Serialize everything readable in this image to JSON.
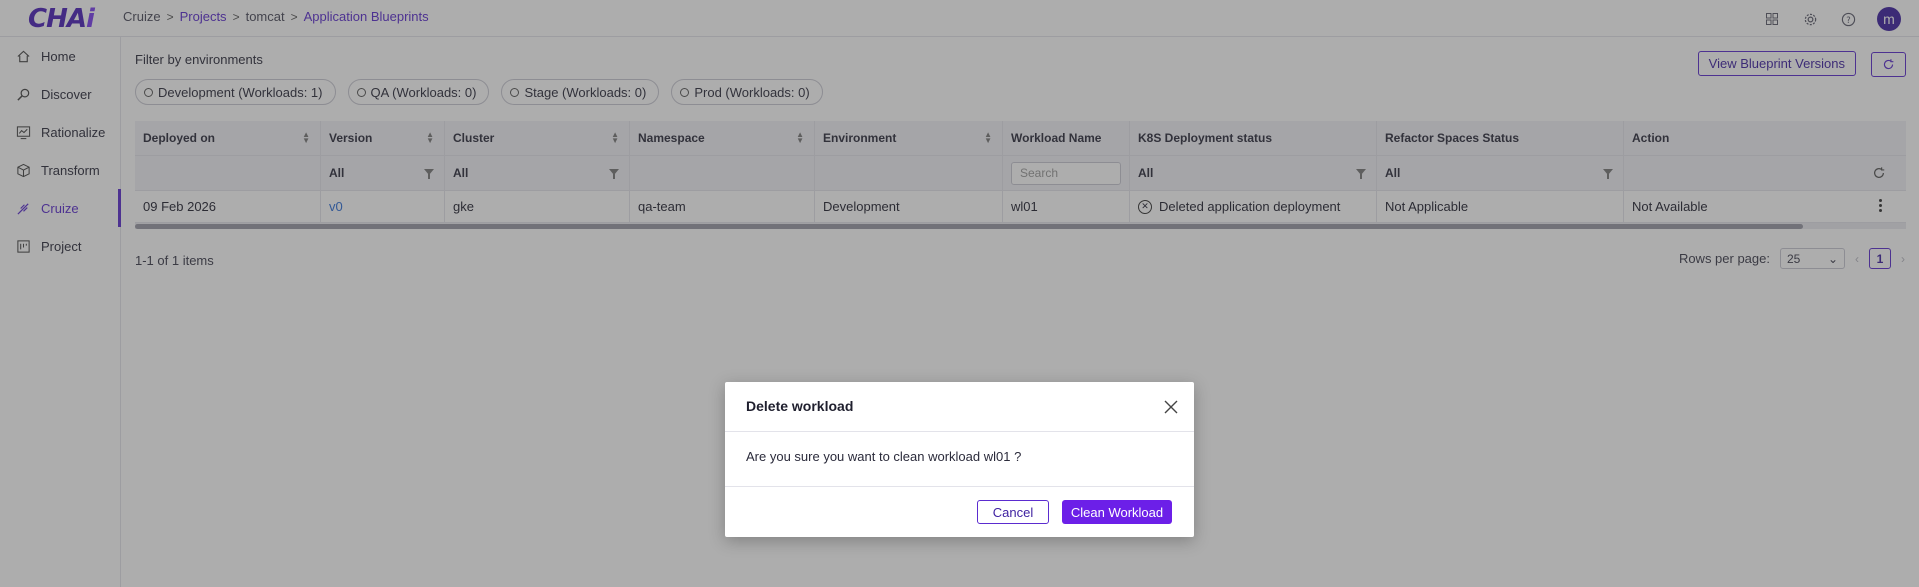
{
  "app": {
    "logo_main": "CHA",
    "logo_accent": "i"
  },
  "breadcrumb": [
    "Cruize",
    "Projects",
    "tomcat",
    "Application Blueprints"
  ],
  "sidebar": {
    "items": [
      {
        "label": "Home",
        "icon": "home-icon"
      },
      {
        "label": "Discover",
        "icon": "discover-icon"
      },
      {
        "label": "Rationalize",
        "icon": "rationalize-icon"
      },
      {
        "label": "Transform",
        "icon": "transform-icon"
      },
      {
        "label": "Cruize",
        "icon": "cruize-icon",
        "active": true
      },
      {
        "label": "Project",
        "icon": "project-icon"
      }
    ]
  },
  "topbar": {
    "avatar_initial": "m"
  },
  "filters": {
    "label": "Filter by environments",
    "environments": [
      "Development (Workloads: 1)",
      "QA (Workloads: 0)",
      "Stage (Workloads: 0)",
      "Prod (Workloads: 0)"
    ]
  },
  "actions": {
    "view_versions": "View Blueprint Versions"
  },
  "table": {
    "columns": [
      "Deployed on",
      "Version",
      "Cluster",
      "Namespace",
      "Environment",
      "Workload Name",
      "K8S Deployment status",
      "Refactor Spaces Status",
      "Action"
    ],
    "filters": {
      "version": "All",
      "cluster": "All",
      "workload_search_placeholder": "Search",
      "k8s_status": "All",
      "refactor_status": "All"
    },
    "rows": [
      {
        "deployed_on": "09 Feb 2026",
        "version": "v0",
        "cluster": "gke",
        "namespace": "qa-team",
        "environment": "Development",
        "workload_name": "wl01",
        "k8s_status": "Deleted application deployment",
        "refactor_status": "Not Applicable",
        "action": "Not Available"
      }
    ]
  },
  "pagination": {
    "count_text": "1-1 of 1 items",
    "rows_per_page_label": "Rows per page:",
    "rows_per_page": "25",
    "current_page": "1"
  },
  "modal": {
    "title": "Delete workload",
    "message": "Are you sure you want to clean workload wl01 ?",
    "cancel": "Cancel",
    "confirm": "Clean Workload"
  },
  "colors": {
    "accent": "#5b2ccf",
    "primary_button": "#6c1fe8",
    "link": "#2f6fd8"
  }
}
